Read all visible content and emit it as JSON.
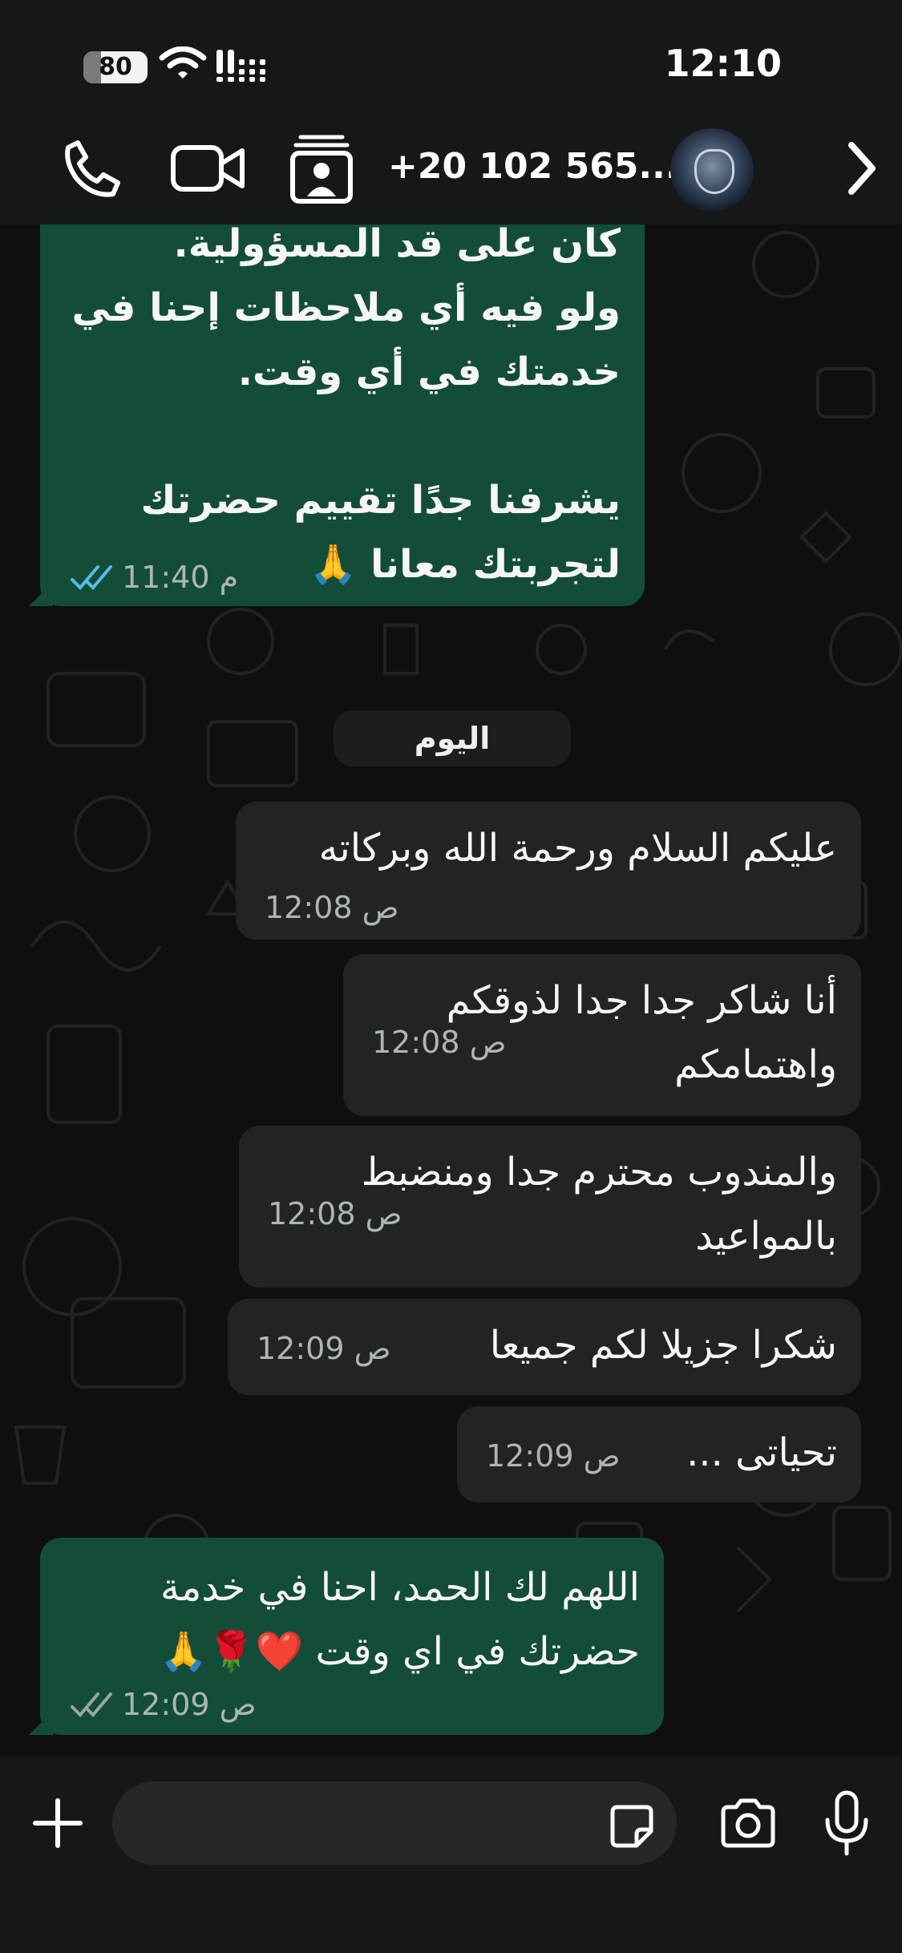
{
  "status_bar": {
    "battery": "80",
    "time": "12:10"
  },
  "header": {
    "contact_name": "+20 102 565..."
  },
  "day_divider": "اليوم",
  "messages": [
    {
      "dir": "out",
      "text": "كان على قد المسؤولية.\nولو فيه أي ملاحظات إحنا في\nخدمتك في أي وقت.\n\nيشرفنا جدًا تقييم حضرتك\nلتجربتك معانا 🙏",
      "time": "11:40 م"
    },
    {
      "dir": "in",
      "text": "عليكم السلام ورحمة الله وبركاته",
      "time": "12:08 ص"
    },
    {
      "dir": "in",
      "text": "أنا شاكر جدا جدا لذوقكم\nواهتمامكم",
      "time": "12:08 ص"
    },
    {
      "dir": "in",
      "text": "والمندوب محترم جدا ومنضبط\nبالمواعيد",
      "time": "12:08 ص"
    },
    {
      "dir": "in",
      "text": "شكرا جزيلا لكم جميعا",
      "time": "12:09 ص"
    },
    {
      "dir": "in",
      "text": "تحياتى ...",
      "time": "12:09 ص"
    },
    {
      "dir": "out",
      "text": "اللهم لك الحمد، احنا في خدمة\nحضرتك في اي وقت ❤️🌹🙏",
      "time": "12:09 ص"
    }
  ],
  "colors": {
    "outgoing_bubble": "#134d37",
    "incoming_bubble": "#222423",
    "read_ticks": "#53bdeb",
    "background": "#0f0f0f"
  }
}
